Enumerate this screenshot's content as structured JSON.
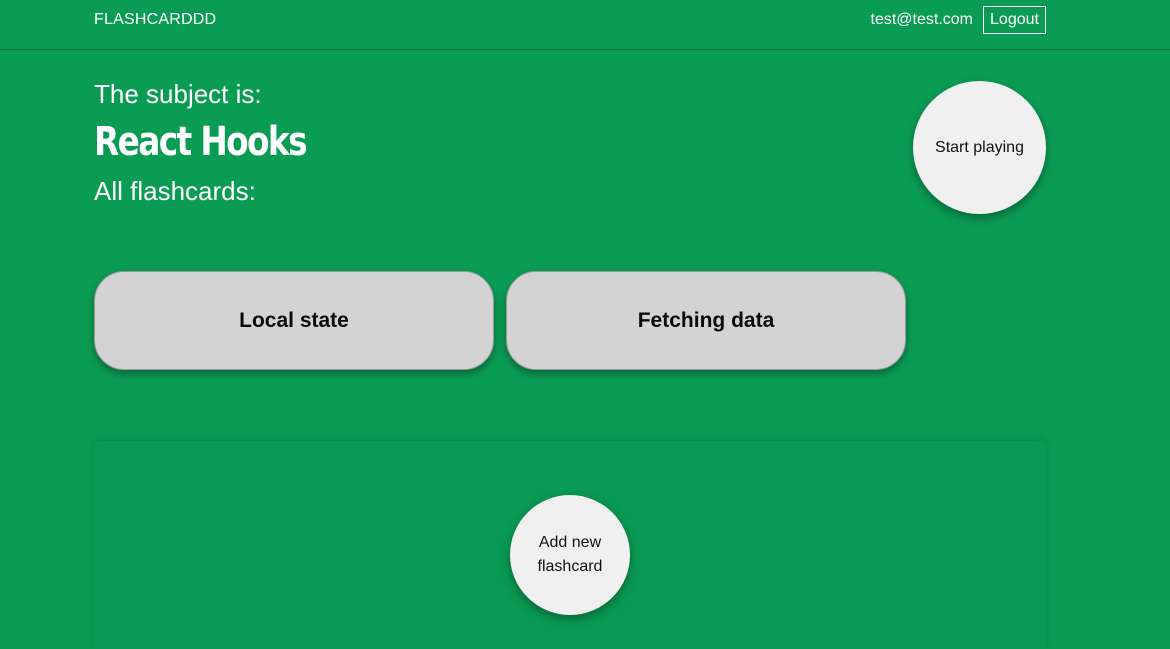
{
  "navbar": {
    "brand": "FLASHCARDDD",
    "user_email": "test@test.com",
    "logout_label": "Logout"
  },
  "subject": {
    "intro": "The subject is:",
    "title": "React Hooks",
    "cards_label": "All flashcards:"
  },
  "actions": {
    "start_playing_label": "Start playing",
    "add_flashcard_label": "Add new flashcard"
  },
  "flashcards": [
    {
      "title": "Local state"
    },
    {
      "title": "Fetching data"
    }
  ],
  "colors": {
    "background": "#0b9c54",
    "card": "#d3d3d3",
    "button": "#f0f0f0",
    "text_light": "#ffffff"
  }
}
